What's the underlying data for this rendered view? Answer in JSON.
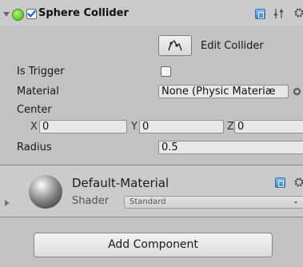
{
  "component": {
    "title": "Sphere Collider",
    "enabled": true,
    "expanded": true,
    "icons": [
      "foldout-arrow-icon",
      "sphere-collider-icon",
      "help-icon",
      "preset-icon",
      "gear-icon"
    ]
  },
  "edit_collider": {
    "label": "Edit Collider",
    "icon": "edit-collider-icon"
  },
  "is_trigger": {
    "label": "Is Trigger",
    "checked": false
  },
  "material": {
    "label": "Material",
    "value": "None (Physic Materiæ",
    "icon": "object-picker-icon"
  },
  "center": {
    "label": "Center",
    "x_label": "X",
    "x": "0",
    "y_label": "Y",
    "y": "0",
    "z_label": "Z",
    "z": "0"
  },
  "radius": {
    "label": "Radius",
    "value": "0.5"
  },
  "material_asset": {
    "name": "Default-Material",
    "shader_label": "Shader",
    "shader_value": "Standard",
    "icons": [
      "material-sphere-preview-icon",
      "help-icon",
      "gear-icon",
      "foldout-arrow-icon",
      "dropdown-arrow-icon"
    ]
  },
  "add_component": {
    "label": "Add Component"
  },
  "colors": {
    "panel_bg": "#c2c2c2",
    "header_bg": "#cbcbcb",
    "field_bg": "#e8e8e8",
    "checkbox_accent": "#1b5fb6",
    "collider_icon": "#6fd33a"
  }
}
